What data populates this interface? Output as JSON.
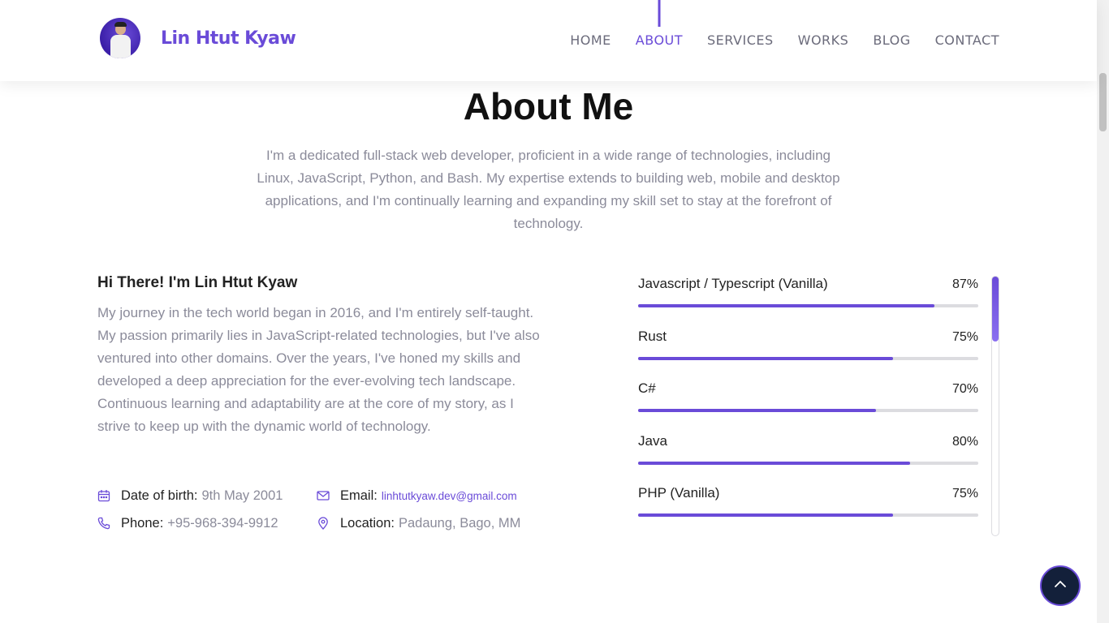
{
  "header": {
    "brand": "Lin Htut Kyaw",
    "nav": [
      {
        "label": "HOME"
      },
      {
        "label": "ABOUT",
        "active": true
      },
      {
        "label": "SERVICES"
      },
      {
        "label": "WORKS"
      },
      {
        "label": "BLOG"
      },
      {
        "label": "CONTACT"
      }
    ]
  },
  "about": {
    "title": "About Me",
    "intro": "I'm a dedicated full-stack web developer, proficient in a wide range of technologies, including Linux, JavaScript, Python, and Bash. My expertise extends to building web, mobile and desktop applications, and I'm continually learning and expanding my skill set to stay at the forefront of technology.",
    "greeting": "Hi There! I'm Lin Htut Kyaw",
    "story": "My journey in the tech world began in 2016, and I'm entirely self-taught. My passion primarily lies in JavaScript-related technologies, but I've also ventured into other domains. Over the years, I've honed my skills and developed a deep appreciation for the ever-evolving tech landscape. Continuous learning and adaptability are at the core of my story, as I strive to keep up with the dynamic world of technology.",
    "info": {
      "dob_label": "Date of birth:",
      "dob_value": "9th May 2001",
      "email_label": "Email:",
      "email_value": "linhtutkyaw.dev@gmail.com",
      "phone_label": "Phone:",
      "phone_value": "+95-968-394-9912",
      "location_label": "Location:",
      "location_value": "Padaung, Bago, MM"
    }
  },
  "skills": [
    {
      "name": "Javascript / Typescript (Vanilla)",
      "percent": "87%",
      "value": 87
    },
    {
      "name": "Rust",
      "percent": "75%",
      "value": 75
    },
    {
      "name": "C#",
      "percent": "70%",
      "value": 70
    },
    {
      "name": "Java",
      "percent": "80%",
      "value": 80
    },
    {
      "name": "PHP (Vanilla)",
      "percent": "75%",
      "value": 75
    }
  ],
  "colors": {
    "accent": "#6a4bd8",
    "muted_text": "#8b8b9a",
    "back_to_top_bg": "#13203a"
  }
}
